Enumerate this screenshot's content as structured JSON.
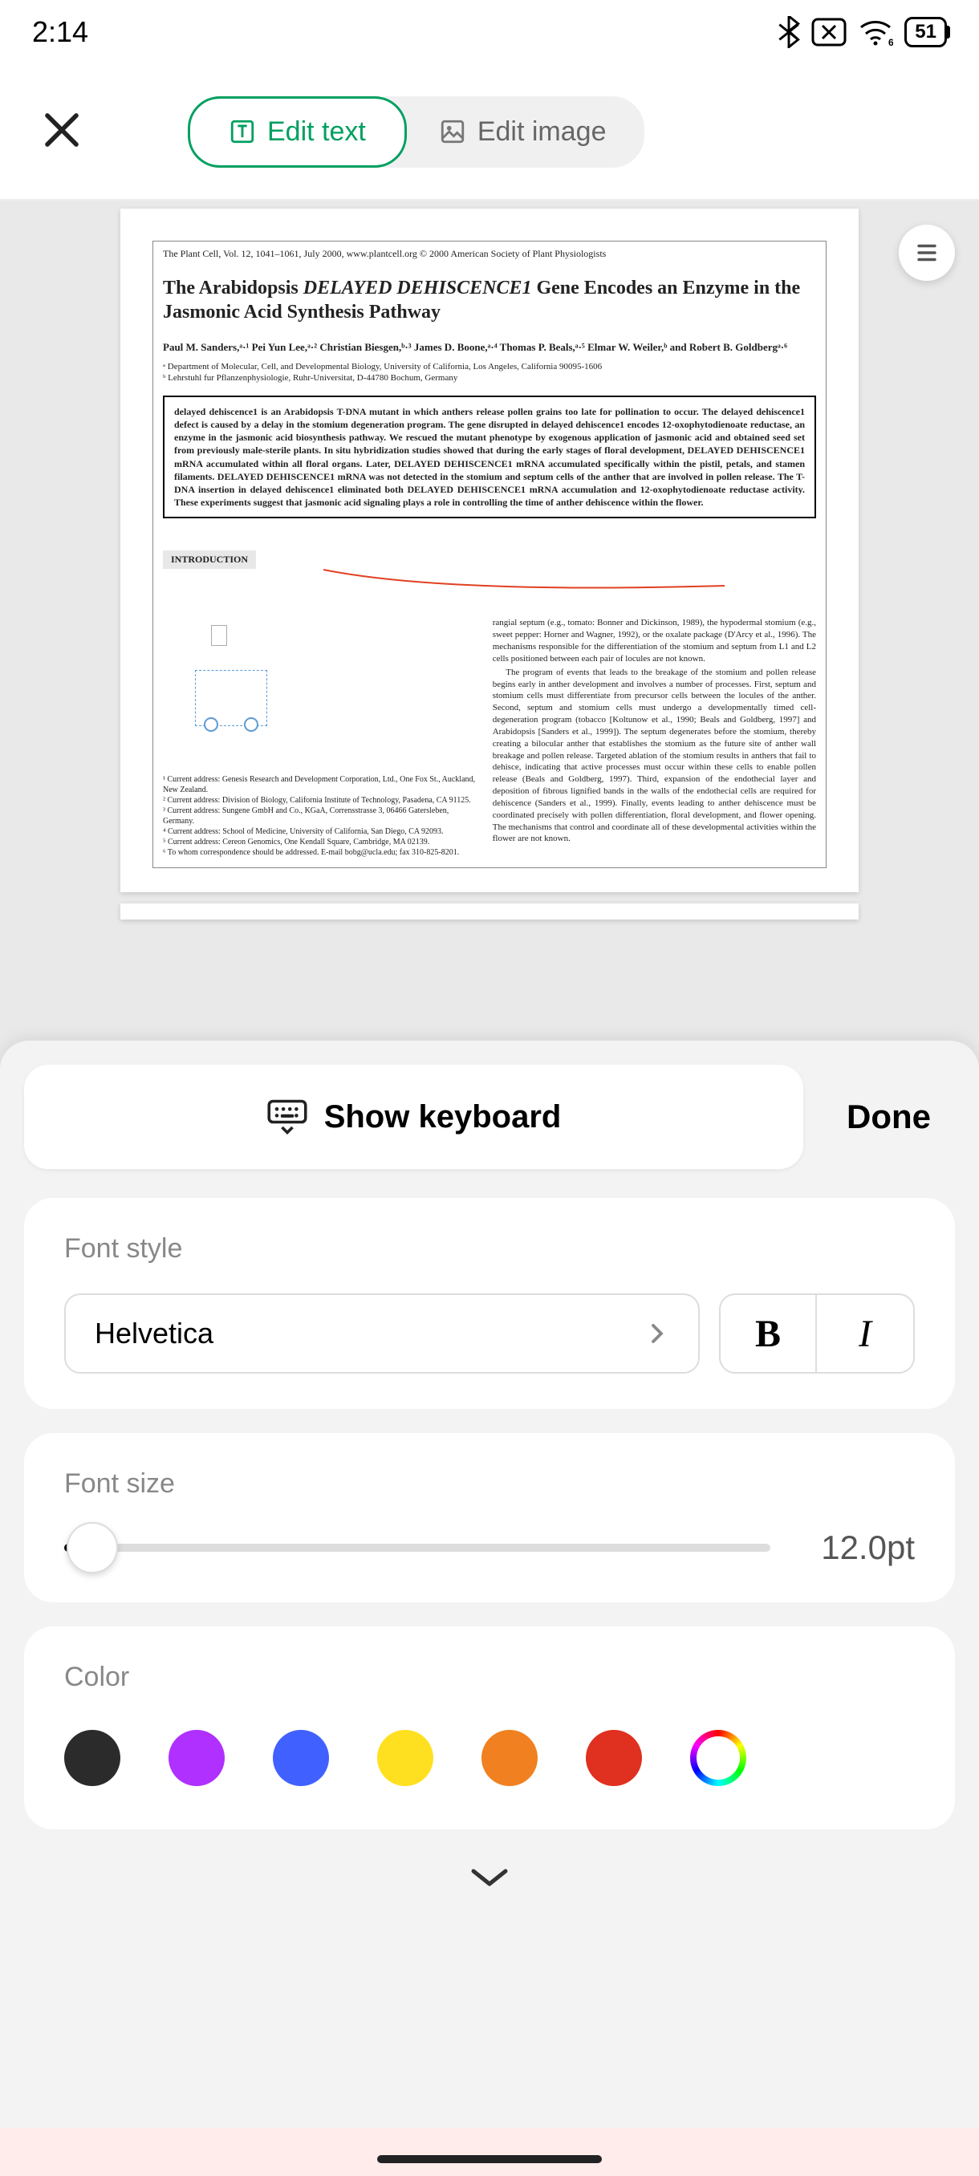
{
  "status": {
    "time": "2:14",
    "battery": "51"
  },
  "toolbar": {
    "edit_text": "Edit text",
    "edit_image": "Edit image"
  },
  "document": {
    "journal": "The Plant Cell, Vol. 12, 1041–1061, July 2000, www.plantcell.org © 2000 American Society of Plant Physiologists",
    "title_pre": "The Arabidopsis ",
    "title_ital": "DELAYED DEHISCENCE1",
    "title_post": " Gene Encodes an Enzyme in the Jasmonic Acid Synthesis Pathway",
    "authors": "Paul M. Sanders,ᵃ·¹ Pei Yun Lee,ᵃ·² Christian Biesgen,ᵇ·³ James D. Boone,ᵃ·⁴ Thomas P. Beals,ᵃ·⁵ Elmar W. Weiler,ᵇ and Robert B. Goldbergᵃ·⁶",
    "affil_a": "ᵃ Department of Molecular, Cell, and Developmental Biology, University of California, Los Angeles, California 90095-1606",
    "affil_b": "ᵇ Lehrstuhl fur Pflanzenphysiologie, Ruhr-Universitat, D-44780 Bochum, Germany",
    "abstract": "delayed dehiscence1 is an Arabidopsis T-DNA mutant in which anthers release pollen grains too late for pollination to occur. The delayed dehiscence1 defect is caused by a delay in the stomium degeneration program. The gene disrupted in delayed dehiscence1 encodes 12-oxophytodienoate reductase, an enzyme in the jasmonic acid biosynthesis pathway. We rescued the mutant phenotype by exogenous application of jasmonic acid and obtained seed set from previously male-sterile plants. In situ hybridization studies showed that during the early stages of floral development, DELAYED DEHISCENCE1 mRNA accumulated within all floral organs. Later, DELAYED DEHISCENCE1 mRNA accumulated specifically within the pistil, petals, and stamen filaments. DELAYED DEHISCENCE1 mRNA was not detected in the stomium and septum cells of the anther that are involved in pollen release. The T-DNA insertion in delayed dehiscence1 eliminated both DELAYED DEHISCENCE1 mRNA accumulation and 12-oxophytodienoate reductase activity. These experiments suggest that jasmonic acid signaling plays a role in controlling the time of anther dehiscence within the flower.",
    "intro_label": "INTRODUCTION",
    "col_right_p1": "rangial septum (e.g., tomato: Bonner and Dickinson, 1989), the hypodermal stomium (e.g., sweet pepper: Horner and Wagner, 1992), or the oxalate package (D'Arcy et al., 1996). The mechanisms responsible for the differentiation of the stomium and septum from L1 and L2 cells positioned between each pair of locules are not known.",
    "col_right_p2": "The program of events that leads to the breakage of the stomium and pollen release begins early in anther development and involves a number of processes. First, septum and stomium cells must differentiate from precursor cells between the locules of the anther. Second, septum and stomium cells must undergo a developmentally timed cell-degeneration program (tobacco [Koltunow et al., 1990; Beals and Goldberg, 1997] and Arabidopsis [Sanders et al., 1999]). The septum degenerates before the stomium, thereby creating a bilocular anther that establishes the stomium as the future site of anther wall breakage and pollen release. Targeted ablation of the stomium results in anthers that fail to dehisce, indicating that active processes must occur within these cells to enable pollen release (Beals and Goldberg, 1997). Third, expansion of the endothecial layer and deposition of fibrous lignified bands in the walls of the endothecial cells are required for dehiscence (Sanders et al., 1999). Finally, events leading to anther dehiscence must be coordinated precisely with pollen differentiation, floral development, and flower opening. The mechanisms that control and coordinate all of these developmental activities within the flower are not known.",
    "footnotes": "¹ Current address: Genesis Research and Development Corporation, Ltd., One Fox St., Auckland, New Zealand.\n² Current address: Division of Biology, California Institute of Technology, Pasadena, CA 91125.\n³ Current address: Sungene GmbH and Co., KGaA, Corrensstrasse 3, 06466 Gatersleben, Germany.\n⁴ Current address: School of Medicine, University of California, San Diego, CA 92093.\n⁵ Current address: Cereon Genomics, One Kendall Square, Cambridge, MA 02139.\n⁶ To whom correspondence should be addressed. E-mail bobg@ucla.edu; fax 310-825-8201."
  },
  "sheet": {
    "show_keyboard": "Show keyboard",
    "done": "Done",
    "font_style_label": "Font style",
    "font_family": "Helvetica",
    "font_size_label": "Font size",
    "font_size_value": "12.0pt",
    "color_label": "Color",
    "colors": [
      "#2b2b2b",
      "#b030ff",
      "#4060ff",
      "#ffe020",
      "#f08020",
      "#e03020"
    ]
  }
}
